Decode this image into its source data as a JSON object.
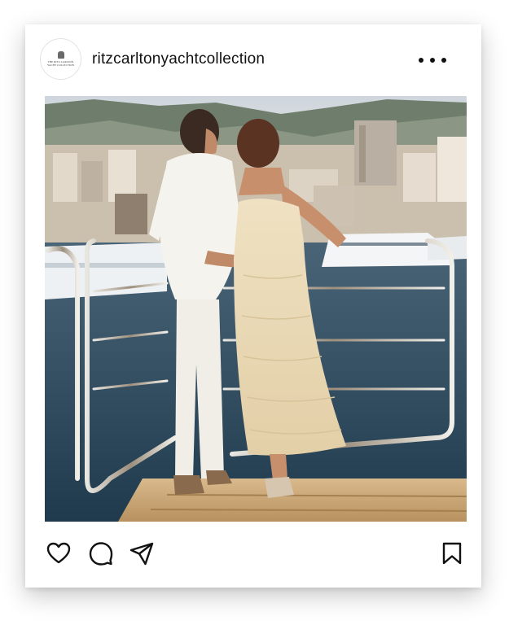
{
  "post": {
    "username": "ritzcarltonyachtcollection",
    "avatar": {
      "line1": "THE RITZ-CARLTON",
      "line2": "YACHT COLLECTION"
    },
    "more_icon": "more-horizontal-icon"
  },
  "actions": {
    "like_icon": "heart-icon",
    "comment_icon": "comment-icon",
    "share_icon": "send-icon",
    "save_icon": "bookmark-icon"
  },
  "colors": {
    "text": "#111111",
    "card": "#ffffff",
    "sea": "#2c4a5e",
    "sky": "#d9dde2"
  }
}
